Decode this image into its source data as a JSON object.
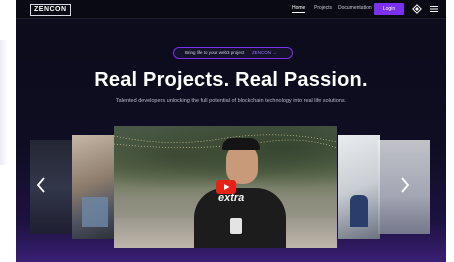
{
  "nav": {
    "logo": "ZENCON",
    "links": [
      "Home",
      "Projects",
      "Documentation"
    ],
    "login_label": "Login",
    "theme_icon": "diamond-icon",
    "menu_icon": "hamburger-menu-icon"
  },
  "hero": {
    "pill_text": "Bring life to your web3 project",
    "pill_link": "ZENCON →",
    "headline": "Real Projects. Real Passion.",
    "subline": "Talented developers unlocking the full potential of blockchain technology into real life solutions."
  },
  "carousel": {
    "shirt_text": "extra",
    "prev_icon": "chevron-left-icon",
    "next_icon": "chevron-right-icon",
    "play_icon": "youtube-play-icon"
  },
  "colors": {
    "accent": "#7b2ff0",
    "background": "#0c0c1a",
    "play_red": "#e62117"
  }
}
